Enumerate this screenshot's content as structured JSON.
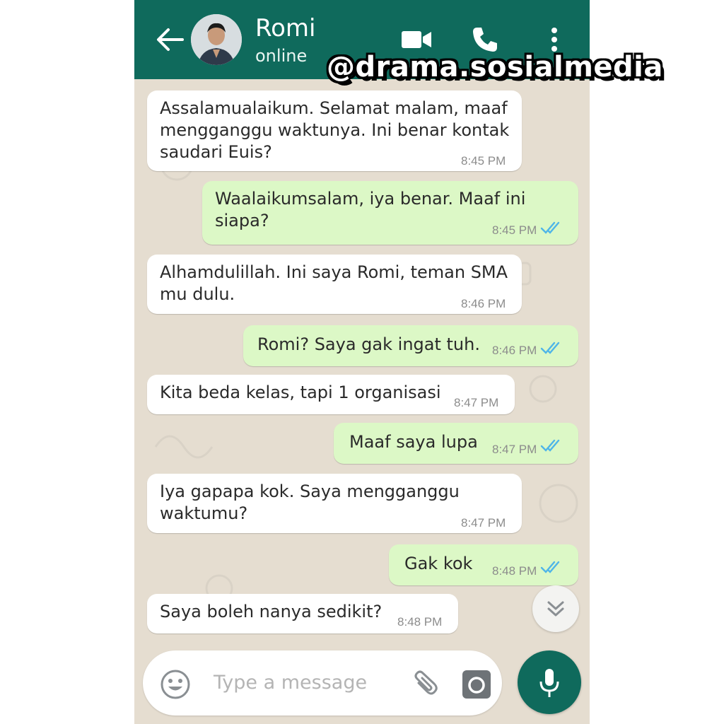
{
  "header": {
    "contact_name": "Romi",
    "status": "online",
    "bg_color": "#0f6a5c"
  },
  "watermark": "@drama.sosialmedia",
  "messages": [
    {
      "direction": "incoming",
      "text": "Assalamualaikum. Selamat malam, maaf\nmengganggu waktunya. Ini benar kontak\nsaudari Euis?",
      "time": "8:45 PM"
    },
    {
      "direction": "outgoing",
      "text": "Waalaikumsalam, iya benar. Maaf ini\nsiapa?",
      "time": "8:45 PM",
      "status": "read"
    },
    {
      "direction": "incoming",
      "text": "Alhamdulillah. Ini saya Romi, teman SMA\nmu dulu.",
      "time": "8:46 PM"
    },
    {
      "direction": "outgoing",
      "text": "Romi? Saya gak ingat tuh.",
      "time": "8:46 PM",
      "status": "read"
    },
    {
      "direction": "incoming",
      "text": "Kita beda kelas, tapi 1 organisasi",
      "time": "8:47 PM"
    },
    {
      "direction": "outgoing",
      "text": "Maaf saya lupa",
      "time": "8:47 PM",
      "status": "read"
    },
    {
      "direction": "incoming",
      "text": "Iya gapapa kok. Saya mengganggu\nwaktumu?",
      "time": "8:47 PM"
    },
    {
      "direction": "outgoing",
      "text": "Gak kok",
      "time": "8:48 PM",
      "status": "read"
    },
    {
      "direction": "incoming",
      "text": "Saya boleh nanya sedikit?",
      "time": "8:48 PM"
    }
  ],
  "composer": {
    "placeholder": "Type a message"
  },
  "colors": {
    "incoming_bubble": "#ffffff",
    "outgoing_bubble": "#dcf8c6",
    "read_ticks": "#4fb5e8",
    "chat_background": "#e5ddd0"
  },
  "icons": [
    "back-arrow-icon",
    "video-call-icon",
    "phone-icon",
    "more-vert-icon",
    "scroll-down-icon",
    "emoji-icon",
    "attach-icon",
    "camera-icon",
    "mic-icon"
  ]
}
